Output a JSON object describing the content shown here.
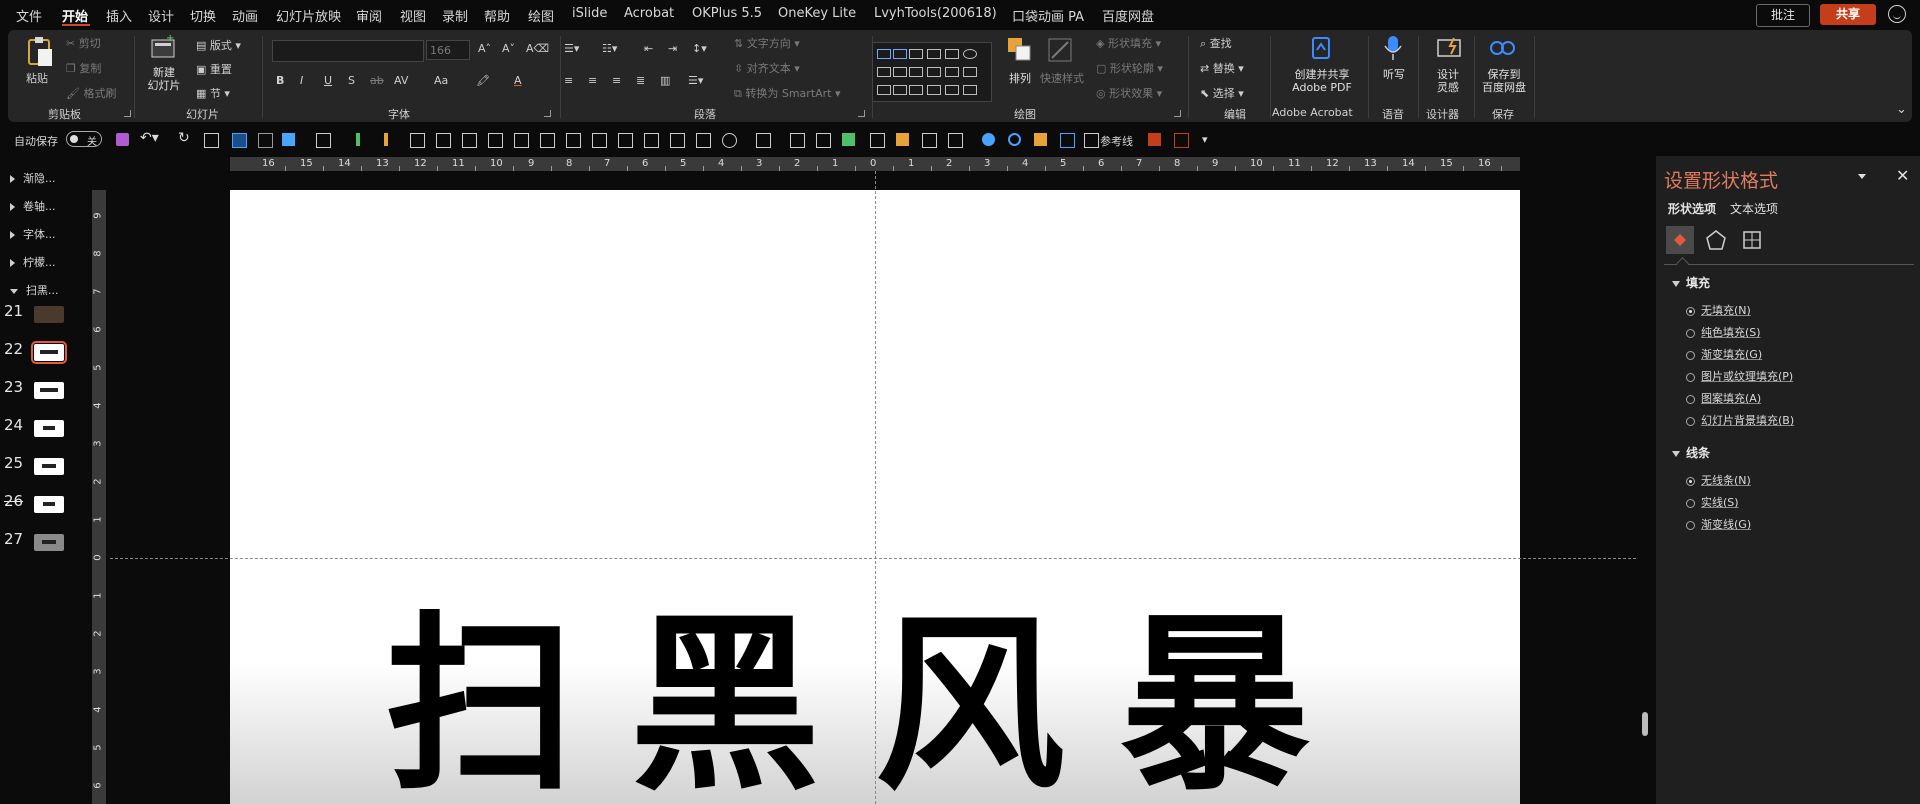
{
  "menu": {
    "items": [
      "文件",
      "开始",
      "插入",
      "设计",
      "切换",
      "动画",
      "幻灯片放映",
      "审阅",
      "视图",
      "录制",
      "帮助",
      "绘图",
      "iSlide",
      "Acrobat",
      "OKPlus 5.5",
      "OneKey Lite",
      "LvyhTools(200618)",
      "口袋动画 PA",
      "百度网盘"
    ],
    "active": "开始",
    "comment": "批注",
    "share": "共享"
  },
  "ribbon": {
    "clipboard": {
      "paste": "粘贴",
      "cut": "剪切",
      "copy": "复制",
      "format_painter": "格式刷",
      "group": "剪贴板"
    },
    "slides": {
      "new_slide": "新建",
      "new_slide2": "幻灯片",
      "layout": "版式",
      "reset": "重置",
      "section": "节",
      "group": "幻灯片"
    },
    "font": {
      "font_size": "166",
      "group": "字体",
      "bold": "B",
      "italic": "I",
      "underline": "U",
      "strike": "S",
      "shadow": "ab",
      "spacing": "AV",
      "case": "Aa",
      "color": "A"
    },
    "paragraph": {
      "text_direction": "文字方向",
      "align_text": "对齐文本",
      "smartart": "转换为 SmartArt",
      "group": "段落"
    },
    "drawing": {
      "arrange": "排列",
      "quick_styles": "快速样式",
      "shape_fill": "形状填充",
      "shape_outline": "形状轮廓",
      "shape_effects": "形状效果",
      "group": "绘图"
    },
    "editing": {
      "find": "查找",
      "replace": "替换",
      "select": "选择",
      "group": "编辑"
    },
    "acrobat": {
      "create": "创建并共享",
      "adobe_pdf": "Adobe PDF",
      "group": "Adobe Acrobat"
    },
    "voice": {
      "dictate": "听写",
      "group": "语音"
    },
    "designer": {
      "design": "设计",
      "ideas": "灵感",
      "group": "设计器"
    },
    "save": {
      "save_to": "保存到",
      "baidu": "百度网盘",
      "group": "保存"
    }
  },
  "qat": {
    "autosave": "自动保存",
    "off": "关",
    "guides": "参考线"
  },
  "sections": [
    "渐隐...",
    "卷轴...",
    "字体...",
    "柠檬...",
    "扫黑..."
  ],
  "slides": [
    "21",
    "22",
    "23",
    "24",
    "25",
    "26",
    "27"
  ],
  "ruler": {
    "h": [
      "16",
      "15",
      "14",
      "13",
      "12",
      "11",
      "10",
      "9",
      "8",
      "7",
      "6",
      "5",
      "4",
      "3",
      "2",
      "1",
      "0",
      "1",
      "2",
      "3",
      "4",
      "5",
      "6",
      "7",
      "8",
      "9",
      "10",
      "11",
      "12",
      "13",
      "14",
      "15",
      "16"
    ],
    "v": [
      "9",
      "8",
      "7",
      "6",
      "5",
      "4",
      "3",
      "2",
      "1",
      "0",
      "1",
      "2",
      "3",
      "4",
      "5",
      "6"
    ]
  },
  "slide": {
    "title_text": "扫黑风暴"
  },
  "panel": {
    "title": "设置形状格式",
    "tab_shape": "形状选项",
    "tab_text": "文本选项",
    "fill_header": "填充",
    "fill_options": [
      "无填充(N)",
      "纯色填充(S)",
      "渐变填充(G)",
      "图片或纹理填充(P)",
      "图案填充(A)",
      "幻灯片背景填充(B)"
    ],
    "line_header": "线条",
    "line_options": [
      "无线条(N)",
      "实线(S)",
      "渐变线(G)"
    ]
  },
  "colors": {
    "accent": "#d24726",
    "share_bg": "#c43e1c",
    "panel_title": "#e07b5f"
  },
  "icons": [
    "paste-icon",
    "cut-icon",
    "copy-icon",
    "format-painter-icon",
    "new-slide-icon",
    "find-icon",
    "replace-icon",
    "select-icon",
    "adobe-pdf-icon",
    "microphone-icon",
    "designer-icon",
    "baidu-cloud-icon",
    "save-icon",
    "undo-icon",
    "redo-icon",
    "fill-line-icon",
    "effects-icon",
    "size-properties-icon"
  ]
}
